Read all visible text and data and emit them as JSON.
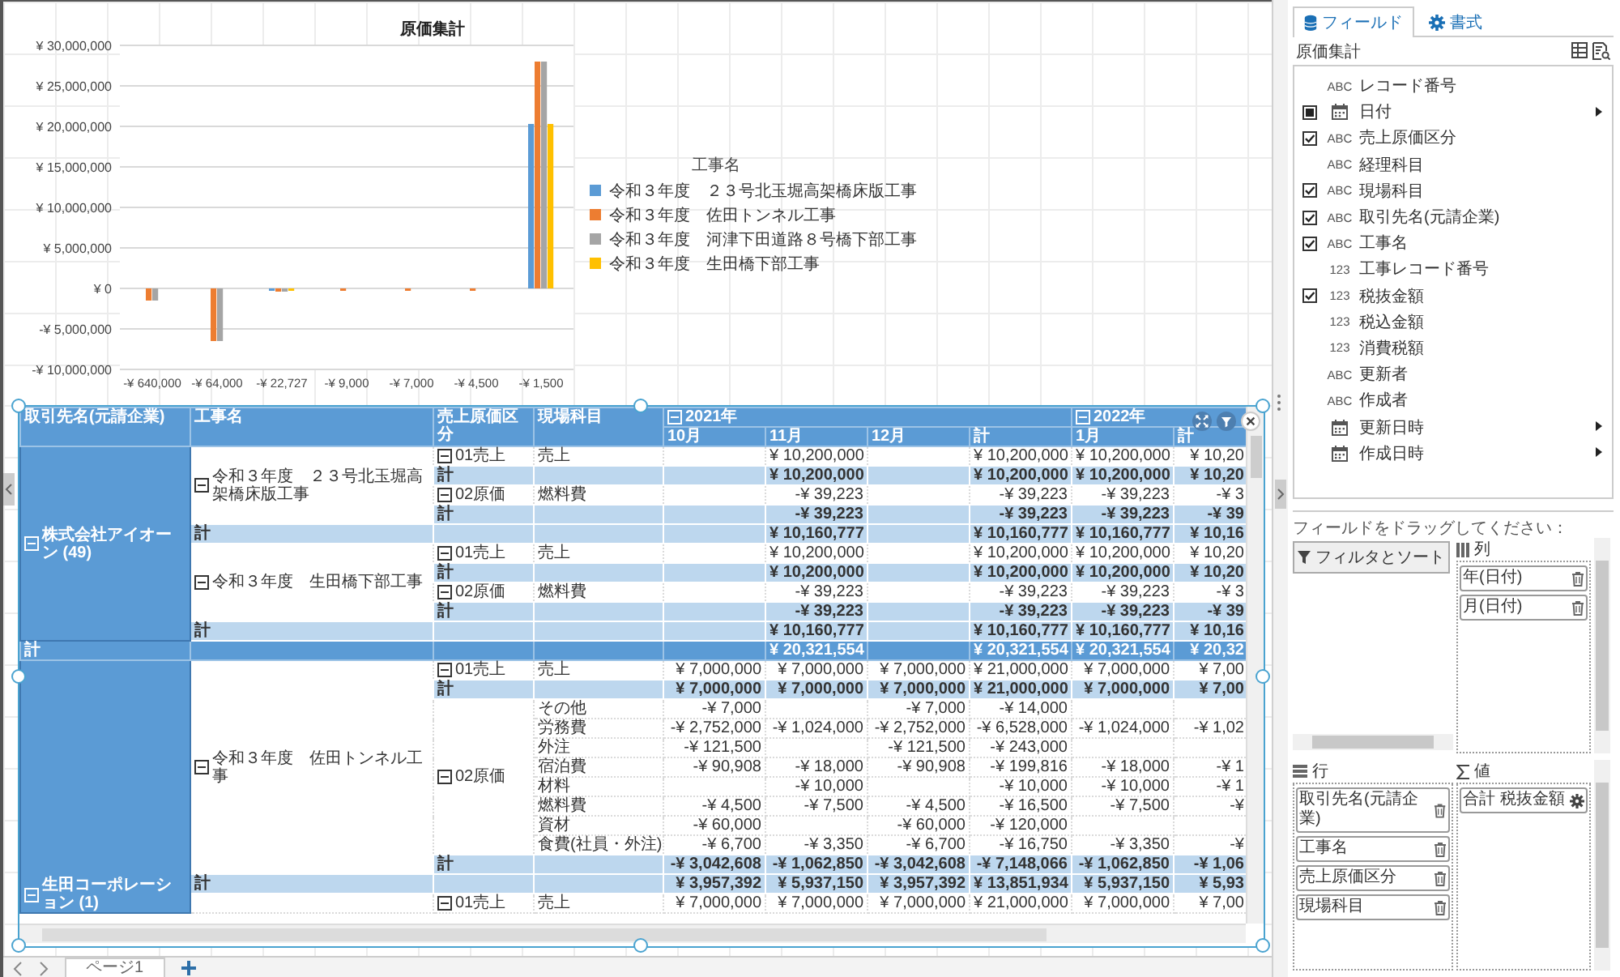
{
  "chart": {
    "legend_title": "工事名",
    "chart_data": {
      "type": "bar",
      "title": "原価集計",
      "grid": true,
      "legend": true,
      "categories": [
        "-¥ 640,000",
        "-¥ 64,000",
        "-¥ 22,727",
        "-¥ 9,000",
        "-¥ 7,000",
        "-¥ 4,500",
        "-¥ 1,500"
      ],
      "series": [
        {
          "name": "令和３年度　２３号北玉堀高架橋床版工事",
          "color": "#5b9bd5",
          "values": [
            null,
            null,
            -300000,
            null,
            null,
            null,
            20300000
          ]
        },
        {
          "name": "令和３年度　佐田トンネル工事",
          "color": "#ed7d31",
          "values": [
            -1500000,
            -6500000,
            -400000,
            -300000,
            -300000,
            -300000,
            28000000
          ]
        },
        {
          "name": "令和３年度　河津下田道路８号橋下部工事",
          "color": "#a5a5a5",
          "values": [
            -1500000,
            -6500000,
            -400000,
            null,
            null,
            null,
            28000000
          ]
        },
        {
          "name": "令和３年度　生田橋下部工事",
          "color": "#ffc000",
          "values": [
            null,
            null,
            -300000,
            null,
            null,
            null,
            20300000
          ]
        }
      ],
      "ylim": [
        -10000000,
        30000000
      ],
      "yticks": [
        {
          "value": -10000000,
          "label": "-¥ 10,000,000"
        },
        {
          "value": -5000000,
          "label": "-¥ 5,000,000"
        },
        {
          "value": 0,
          "label": "¥ 0"
        },
        {
          "value": 5000000,
          "label": "¥ 5,000,000"
        },
        {
          "value": 10000000,
          "label": "¥ 10,000,000"
        },
        {
          "value": 15000000,
          "label": "¥ 15,000,000"
        },
        {
          "value": 20000000,
          "label": "¥ 20,000,000"
        },
        {
          "value": 25000000,
          "label": "¥ 25,000,000"
        },
        {
          "value": 30000000,
          "label": "¥ 30,000,000"
        }
      ]
    }
  },
  "pivot": {
    "row_headers": [
      "取引先名(元請企業)",
      "工事名",
      "売上原価区分",
      "現場科目"
    ],
    "column_groups": [
      {
        "label": "2021年",
        "expanded": true,
        "columns": [
          "10月",
          "11月",
          "12月",
          "計"
        ]
      },
      {
        "label": "2022年",
        "expanded": true,
        "columns": [
          "1月",
          "計"
        ]
      }
    ],
    "clients": [
      {
        "label": "株式会社アイオーン (49)",
        "expanded": true,
        "projects": [
          {
            "label": "令和３年度　２３号北玉堀高架橋床版工事",
            "expanded": true,
            "categories": [
              {
                "label": "01売上",
                "expanded": true,
                "items": [
                  {
                    "label": "売上",
                    "cells": [
                      {
                        "kind": "blank"
                      },
                      {
                        "kind": "amount",
                        "text": "¥ 10,200,000"
                      },
                      {
                        "kind": "blank"
                      },
                      {
                        "kind": "amount",
                        "text": "¥ 10,200,000"
                      },
                      {
                        "kind": "amount",
                        "text": "¥ 10,200,000"
                      },
                      {
                        "kind": "amount",
                        "text": "¥ 10,20"
                      }
                    ]
                  }
                ],
                "total": {
                  "label": "計",
                  "cells": [
                    {
                      "kind": "blank"
                    },
                    {
                      "kind": "amount",
                      "text": "¥ 10,200,000"
                    },
                    {
                      "kind": "blank"
                    },
                    {
                      "kind": "amount",
                      "text": "¥ 10,200,000"
                    },
                    {
                      "kind": "amount",
                      "text": "¥ 10,200,000"
                    },
                    {
                      "kind": "amount",
                      "text": "¥ 10,20"
                    }
                  ]
                }
              },
              {
                "label": "02原価",
                "expanded": true,
                "items": [
                  {
                    "label": "燃料費",
                    "cells": [
                      {
                        "kind": "blank"
                      },
                      {
                        "kind": "amount",
                        "text": "-¥ 39,223"
                      },
                      {
                        "kind": "blank"
                      },
                      {
                        "kind": "amount",
                        "text": "-¥ 39,223"
                      },
                      {
                        "kind": "amount",
                        "text": "-¥ 39,223"
                      },
                      {
                        "kind": "amount",
                        "text": "-¥ 3"
                      }
                    ]
                  }
                ],
                "total": {
                  "label": "計",
                  "cells": [
                    {
                      "kind": "blank"
                    },
                    {
                      "kind": "amount",
                      "text": "-¥ 39,223"
                    },
                    {
                      "kind": "blank"
                    },
                    {
                      "kind": "amount",
                      "text": "-¥ 39,223"
                    },
                    {
                      "kind": "amount",
                      "text": "-¥ 39,223"
                    },
                    {
                      "kind": "amount",
                      "text": "-¥ 39"
                    }
                  ]
                }
              }
            ],
            "total": {
              "label": "計",
              "cells": [
                {
                  "kind": "blank"
                },
                {
                  "kind": "amount",
                  "text": "¥ 10,160,777"
                },
                {
                  "kind": "blank"
                },
                {
                  "kind": "amount",
                  "text": "¥ 10,160,777"
                },
                {
                  "kind": "amount",
                  "text": "¥ 10,160,777"
                },
                {
                  "kind": "amount",
                  "text": "¥ 10,16"
                }
              ]
            }
          },
          {
            "label": "令和３年度　生田橋下部工事",
            "expanded": true,
            "categories": [
              {
                "label": "01売上",
                "expanded": true,
                "items": [
                  {
                    "label": "売上",
                    "cells": [
                      {
                        "kind": "blank"
                      },
                      {
                        "kind": "amount",
                        "text": "¥ 10,200,000"
                      },
                      {
                        "kind": "blank"
                      },
                      {
                        "kind": "amount",
                        "text": "¥ 10,200,000"
                      },
                      {
                        "kind": "amount",
                        "text": "¥ 10,200,000"
                      },
                      {
                        "kind": "amount",
                        "text": "¥ 10,20"
                      }
                    ]
                  }
                ],
                "total": {
                  "label": "計",
                  "cells": [
                    {
                      "kind": "blank"
                    },
                    {
                      "kind": "amount",
                      "text": "¥ 10,200,000"
                    },
                    {
                      "kind": "blank"
                    },
                    {
                      "kind": "amount",
                      "text": "¥ 10,200,000"
                    },
                    {
                      "kind": "amount",
                      "text": "¥ 10,200,000"
                    },
                    {
                      "kind": "amount",
                      "text": "¥ 10,20"
                    }
                  ]
                }
              },
              {
                "label": "02原価",
                "expanded": true,
                "items": [
                  {
                    "label": "燃料費",
                    "cells": [
                      {
                        "kind": "blank"
                      },
                      {
                        "kind": "amount",
                        "text": "-¥ 39,223"
                      },
                      {
                        "kind": "blank"
                      },
                      {
                        "kind": "amount",
                        "text": "-¥ 39,223"
                      },
                      {
                        "kind": "amount",
                        "text": "-¥ 39,223"
                      },
                      {
                        "kind": "amount",
                        "text": "-¥ 3"
                      }
                    ]
                  }
                ],
                "total": {
                  "label": "計",
                  "cells": [
                    {
                      "kind": "blank"
                    },
                    {
                      "kind": "amount",
                      "text": "-¥ 39,223"
                    },
                    {
                      "kind": "blank"
                    },
                    {
                      "kind": "amount",
                      "text": "-¥ 39,223"
                    },
                    {
                      "kind": "amount",
                      "text": "-¥ 39,223"
                    },
                    {
                      "kind": "amount",
                      "text": "-¥ 39"
                    }
                  ]
                }
              }
            ],
            "total": {
              "label": "計",
              "cells": [
                {
                  "kind": "blank"
                },
                {
                  "kind": "amount",
                  "text": "¥ 10,160,777"
                },
                {
                  "kind": "blank"
                },
                {
                  "kind": "amount",
                  "text": "¥ 10,160,777"
                },
                {
                  "kind": "amount",
                  "text": "¥ 10,160,777"
                },
                {
                  "kind": "amount",
                  "text": "¥ 10,16"
                }
              ]
            }
          }
        ],
        "total": {
          "label": "計",
          "cells": [
            {
              "kind": "blank"
            },
            {
              "kind": "amount",
              "text": "¥ 20,321,554"
            },
            {
              "kind": "blank"
            },
            {
              "kind": "amount",
              "text": "¥ 20,321,554"
            },
            {
              "kind": "amount",
              "text": "¥ 20,321,554"
            },
            {
              "kind": "amount",
              "text": "¥ 20,32"
            }
          ]
        }
      },
      {
        "label": "生田コーポレーション (1)",
        "expanded": true,
        "projects": [
          {
            "label": "令和３年度　佐田トンネル工事",
            "expanded": true,
            "categories": [
              {
                "label": "01売上",
                "expanded": true,
                "items": [
                  {
                    "label": "売上",
                    "cells": [
                      {
                        "kind": "amount",
                        "text": "¥ 7,000,000"
                      },
                      {
                        "kind": "amount",
                        "text": "¥ 7,000,000"
                      },
                      {
                        "kind": "amount",
                        "text": "¥ 7,000,000"
                      },
                      {
                        "kind": "amount",
                        "text": "¥ 21,000,000"
                      },
                      {
                        "kind": "amount",
                        "text": "¥ 7,000,000"
                      },
                      {
                        "kind": "amount",
                        "text": "¥ 7,00"
                      }
                    ]
                  }
                ],
                "total": {
                  "label": "計",
                  "cells": [
                    {
                      "kind": "amount",
                      "text": "¥ 7,000,000"
                    },
                    {
                      "kind": "amount",
                      "text": "¥ 7,000,000"
                    },
                    {
                      "kind": "amount",
                      "text": "¥ 7,000,000"
                    },
                    {
                      "kind": "amount",
                      "text": "¥ 21,000,000"
                    },
                    {
                      "kind": "amount",
                      "text": "¥ 7,000,000"
                    },
                    {
                      "kind": "amount",
                      "text": "¥ 7,00"
                    }
                  ]
                }
              },
              {
                "label": "02原価",
                "expanded": true,
                "items": [
                  {
                    "label": "その他",
                    "cells": [
                      {
                        "kind": "amount",
                        "text": "-¥ 7,000"
                      },
                      {
                        "kind": "blank"
                      },
                      {
                        "kind": "amount",
                        "text": "-¥ 7,000"
                      },
                      {
                        "kind": "amount",
                        "text": "-¥ 14,000"
                      },
                      {
                        "kind": "blank"
                      },
                      {
                        "kind": "blank"
                      }
                    ]
                  },
                  {
                    "label": "労務費",
                    "cells": [
                      {
                        "kind": "amount",
                        "text": "-¥ 2,752,000"
                      },
                      {
                        "kind": "amount",
                        "text": "-¥ 1,024,000"
                      },
                      {
                        "kind": "amount",
                        "text": "-¥ 2,752,000"
                      },
                      {
                        "kind": "amount",
                        "text": "-¥ 6,528,000"
                      },
                      {
                        "kind": "amount",
                        "text": "-¥ 1,024,000"
                      },
                      {
                        "kind": "amount",
                        "text": "-¥ 1,02"
                      }
                    ]
                  },
                  {
                    "label": "外注",
                    "cells": [
                      {
                        "kind": "amount",
                        "text": "-¥ 121,500"
                      },
                      {
                        "kind": "blank"
                      },
                      {
                        "kind": "amount",
                        "text": "-¥ 121,500"
                      },
                      {
                        "kind": "amount",
                        "text": "-¥ 243,000"
                      },
                      {
                        "kind": "blank"
                      },
                      {
                        "kind": "blank"
                      }
                    ]
                  },
                  {
                    "label": "宿泊費",
                    "cells": [
                      {
                        "kind": "amount",
                        "text": "-¥ 90,908"
                      },
                      {
                        "kind": "amount",
                        "text": "-¥ 18,000"
                      },
                      {
                        "kind": "amount",
                        "text": "-¥ 90,908"
                      },
                      {
                        "kind": "amount",
                        "text": "-¥ 199,816"
                      },
                      {
                        "kind": "amount",
                        "text": "-¥ 18,000"
                      },
                      {
                        "kind": "amount",
                        "text": "-¥ 1"
                      }
                    ]
                  },
                  {
                    "label": "材料",
                    "cells": [
                      {
                        "kind": "blank"
                      },
                      {
                        "kind": "amount",
                        "text": "-¥ 10,000"
                      },
                      {
                        "kind": "blank"
                      },
                      {
                        "kind": "amount",
                        "text": "-¥ 10,000"
                      },
                      {
                        "kind": "amount",
                        "text": "-¥ 10,000"
                      },
                      {
                        "kind": "amount",
                        "text": "-¥ 1"
                      }
                    ]
                  },
                  {
                    "label": "燃料費",
                    "cells": [
                      {
                        "kind": "amount",
                        "text": "-¥ 4,500"
                      },
                      {
                        "kind": "amount",
                        "text": "-¥ 7,500"
                      },
                      {
                        "kind": "amount",
                        "text": "-¥ 4,500"
                      },
                      {
                        "kind": "amount",
                        "text": "-¥ 16,500"
                      },
                      {
                        "kind": "amount",
                        "text": "-¥ 7,500"
                      },
                      {
                        "kind": "amount",
                        "text": "-¥"
                      }
                    ]
                  },
                  {
                    "label": "資材",
                    "cells": [
                      {
                        "kind": "amount",
                        "text": "-¥ 60,000"
                      },
                      {
                        "kind": "blank"
                      },
                      {
                        "kind": "amount",
                        "text": "-¥ 60,000"
                      },
                      {
                        "kind": "amount",
                        "text": "-¥ 120,000"
                      },
                      {
                        "kind": "blank"
                      },
                      {
                        "kind": "blank"
                      }
                    ]
                  },
                  {
                    "label": "食費(社員・外注)",
                    "cells": [
                      {
                        "kind": "amount",
                        "text": "-¥ 6,700"
                      },
                      {
                        "kind": "amount",
                        "text": "-¥ 3,350"
                      },
                      {
                        "kind": "amount",
                        "text": "-¥ 6,700"
                      },
                      {
                        "kind": "amount",
                        "text": "-¥ 16,750"
                      },
                      {
                        "kind": "amount",
                        "text": "-¥ 3,350"
                      },
                      {
                        "kind": "amount",
                        "text": "-¥"
                      }
                    ]
                  }
                ],
                "total": {
                  "label": "計",
                  "cells": [
                    {
                      "kind": "amount",
                      "text": "-¥ 3,042,608"
                    },
                    {
                      "kind": "amount",
                      "text": "-¥ 1,062,850"
                    },
                    {
                      "kind": "amount",
                      "text": "-¥ 3,042,608"
                    },
                    {
                      "kind": "amount",
                      "text": "-¥ 7,148,066"
                    },
                    {
                      "kind": "amount",
                      "text": "-¥ 1,062,850"
                    },
                    {
                      "kind": "amount",
                      "text": "-¥ 1,06"
                    }
                  ]
                }
              }
            ],
            "total": {
              "label": "計",
              "cells": [
                {
                  "kind": "amount",
                  "text": "¥ 3,957,392"
                },
                {
                  "kind": "amount",
                  "text": "¥ 5,937,150"
                },
                {
                  "kind": "amount",
                  "text": "¥ 3,957,392"
                },
                {
                  "kind": "amount",
                  "text": "¥ 13,851,934"
                },
                {
                  "kind": "amount",
                  "text": "¥ 5,937,150"
                },
                {
                  "kind": "amount",
                  "text": "¥ 5,93"
                }
              ]
            }
          },
          {
            "categories": [
              {
                "label": "01売上",
                "expanded": true,
                "items": [
                  {
                    "label": "売上",
                    "cells": [
                      {
                        "kind": "amount",
                        "text": "¥ 7,000,000"
                      },
                      {
                        "kind": "amount",
                        "text": "¥ 7,000,000"
                      },
                      {
                        "kind": "amount",
                        "text": "¥ 7,000,000"
                      },
                      {
                        "kind": "amount",
                        "text": "¥ 21,000,000"
                      },
                      {
                        "kind": "amount",
                        "text": "¥ 7,000,000"
                      },
                      {
                        "kind": "amount",
                        "text": "¥ 7,00"
                      }
                    ]
                  }
                ]
              }
            ]
          }
        ]
      }
    ]
  },
  "page_tabs": [
    {
      "label": "ページ1",
      "selected": true
    }
  ],
  "fields": {
    "tabs": [
      {
        "label": "フィールド",
        "kind": "fields",
        "selected": true
      },
      {
        "label": "書式",
        "kind": "format",
        "selected": false
      }
    ],
    "dataset": "原価集計",
    "items": [
      {
        "kind": "text",
        "type_label": "ABC",
        "label": "レコード番号",
        "checked": false,
        "partial": false,
        "submenu": false
      },
      {
        "kind": "date",
        "label": "日付",
        "checked": false,
        "partial": true,
        "submenu": true
      },
      {
        "kind": "text",
        "type_label": "ABC",
        "label": "売上原価区分",
        "checked": true,
        "partial": false,
        "submenu": false
      },
      {
        "kind": "text",
        "type_label": "ABC",
        "label": "経理科目",
        "checked": false,
        "partial": false,
        "submenu": false
      },
      {
        "kind": "text",
        "type_label": "ABC",
        "label": "現場科目",
        "checked": true,
        "partial": false,
        "submenu": false
      },
      {
        "kind": "text",
        "type_label": "ABC",
        "label": "取引先名(元請企業)",
        "checked": true,
        "partial": false,
        "submenu": false
      },
      {
        "kind": "text",
        "type_label": "ABC",
        "label": "工事名",
        "checked": true,
        "partial": false,
        "submenu": false
      },
      {
        "kind": "number",
        "type_label": "123",
        "label": "工事レコード番号",
        "checked": false,
        "partial": false,
        "submenu": false
      },
      {
        "kind": "number",
        "type_label": "123",
        "label": "税抜金額",
        "checked": true,
        "partial": false,
        "submenu": false
      },
      {
        "kind": "number",
        "type_label": "123",
        "label": "税込金額",
        "checked": false,
        "partial": false,
        "submenu": false
      },
      {
        "kind": "number",
        "type_label": "123",
        "label": "消費税額",
        "checked": false,
        "partial": false,
        "submenu": false
      },
      {
        "kind": "text",
        "type_label": "ABC",
        "label": "更新者",
        "checked": false,
        "partial": false,
        "submenu": false
      },
      {
        "kind": "text",
        "type_label": "ABC",
        "label": "作成者",
        "checked": false,
        "partial": false,
        "submenu": false
      },
      {
        "kind": "date",
        "label": "更新日時",
        "checked": false,
        "partial": false,
        "submenu": true
      },
      {
        "kind": "date",
        "label": "作成日時",
        "checked": false,
        "partial": false,
        "submenu": true
      }
    ],
    "drop_hint": "フィールドをドラッグしてください：",
    "zones": [
      {
        "kind": "filter",
        "button": "フィルタとソート"
      },
      {
        "kind": "columns",
        "title": "列",
        "chips": [
          "年(日付)",
          "月(日付)"
        ]
      },
      {
        "kind": "rows",
        "title": "行",
        "chips": [
          "取引先名(元請企業)",
          "工事名",
          "売上原価区分",
          "現場科目"
        ]
      },
      {
        "kind": "values",
        "title": "値",
        "chips": [
          "合計 税抜金額"
        ]
      }
    ]
  }
}
